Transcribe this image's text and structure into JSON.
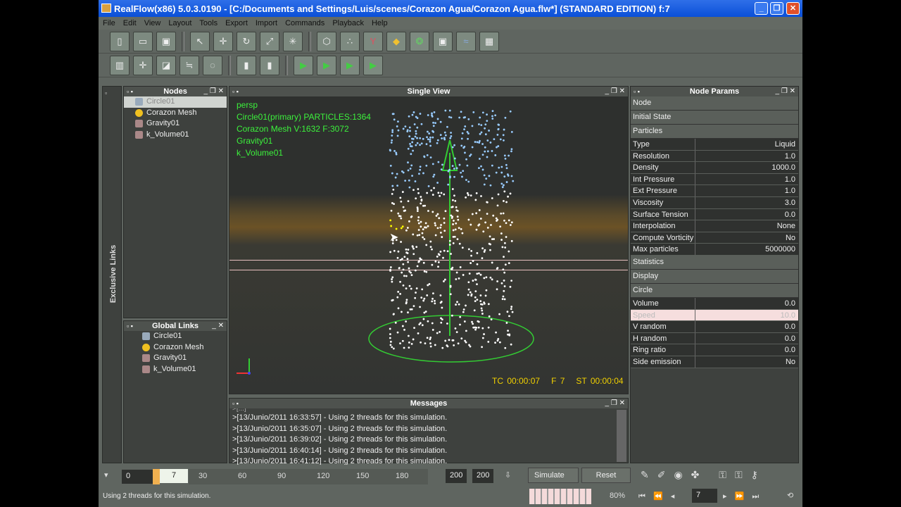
{
  "window": {
    "title": "RealFlow(x86) 5.0.3.0190 - [C:/Documents and Settings/Luis/scenes/Corazon Agua/Corazon Agua.flw*] (STANDARD EDITION) f:7"
  },
  "menu": [
    "File",
    "Edit",
    "View",
    "Layout",
    "Tools",
    "Export",
    "Import",
    "Commands",
    "Playback",
    "Help"
  ],
  "exclusive_links": "Exclusive Links",
  "nodes": {
    "title": "Nodes",
    "items": [
      "Circle01",
      "Corazon Mesh",
      "Gravity01",
      "k_Volume01"
    ]
  },
  "global_links": {
    "title": "Global Links",
    "items": [
      "Circle01",
      "Corazon Mesh",
      "Gravity01",
      "k_Volume01"
    ]
  },
  "viewport": {
    "title": "Single View",
    "hud": [
      "persp",
      "Circle01(primary) PARTICLES:1364",
      "Corazon Mesh V:1632 F:3072",
      "Gravity01",
      "k_Volume01"
    ],
    "tc": "TC 00:00:07",
    "frame": "F 7",
    "st": "ST 00:00:04"
  },
  "messages": {
    "title": "Messages",
    "lines": [
      ">[13/Junio/2011 16:33:57] - Using 2 threads for this simulation.",
      ">[13/Junio/2011 16:35:07] - Using 2 threads for this simulation.",
      ">[13/Junio/2011 16:39:02] - Using 2 threads for this simulation.",
      ">[13/Junio/2011 16:40:14] - Using 2 threads for this simulation.",
      ">[13/Junio/2011 16:41:12] - Using 2 threads for this simulation."
    ]
  },
  "params": {
    "title": "Node Params",
    "sections": [
      "Node",
      "Initial State",
      "Particles",
      "Statistics",
      "Display",
      "Circle"
    ],
    "particles": [
      [
        "Type",
        "Liquid"
      ],
      [
        "Resolution",
        "1.0"
      ],
      [
        "Density",
        "1000.0"
      ],
      [
        "Int Pressure",
        "1.0"
      ],
      [
        "Ext Pressure",
        "1.0"
      ],
      [
        "Viscosity",
        "3.0"
      ],
      [
        "Surface Tension",
        "0.0"
      ],
      [
        "Interpolation",
        "None"
      ],
      [
        "Compute Vorticity",
        "No"
      ],
      [
        "Max particles",
        "5000000"
      ]
    ],
    "circle": [
      [
        "Volume",
        "0.0"
      ],
      [
        "Speed",
        "10.0"
      ],
      [
        "V random",
        "0.0"
      ],
      [
        "H random",
        "0.0"
      ],
      [
        "Ring ratio",
        "0.0"
      ],
      [
        "Side emission",
        "No"
      ]
    ]
  },
  "timeline": {
    "start": "0",
    "current": "7",
    "ticks": [
      "30",
      "60",
      "90",
      "120",
      "150",
      "180"
    ],
    "end1": "200",
    "end2": "200",
    "simulate": "Simulate",
    "reset": "Reset",
    "progress": "80%",
    "frame": "7"
  },
  "status": "Using 2 threads for this simulation."
}
